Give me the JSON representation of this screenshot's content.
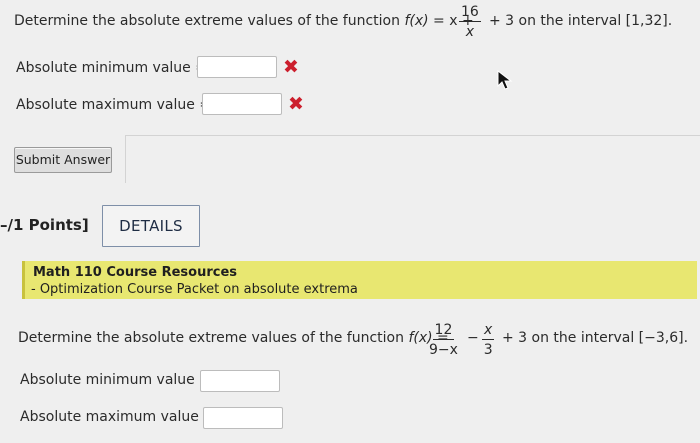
{
  "q1": {
    "prompt_before": "Determine the absolute extreme values of the function",
    "fx": "f(x)",
    "eq": "= x +",
    "frac_num": "16",
    "frac_den": "x",
    "prompt_after": "+ 3 on the interval [1,32].",
    "min_label": "Absolute minimum value =",
    "max_label": "Absolute maximum value =",
    "min_value": "",
    "max_value": "",
    "incorrect_mark": "✖"
  },
  "submit": {
    "label": "Submit Answer"
  },
  "q2_header": {
    "points": "–/1 Points]",
    "details": "DETAILS"
  },
  "resources": {
    "title": "Math 110 Course Resources",
    "link": "- Optimization Course Packet on absolute extrema"
  },
  "q2": {
    "prompt_before": "Determine the absolute extreme values of the function",
    "fx": "f(x)",
    "eq": "=",
    "frac1_num": "12",
    "frac1_den": "9−x",
    "minus": "−",
    "frac2_num": "x",
    "frac2_den": "3",
    "prompt_after": "+ 3 on the interval [−3,6].",
    "min_label": "Absolute minimum value =",
    "max_label": "Absolute maximum value =",
    "min_value": "",
    "max_value": ""
  },
  "colors": {
    "incorrect": "#cc1f2d",
    "highlight": "#e8e771",
    "details_border": "#7e8fa8"
  }
}
